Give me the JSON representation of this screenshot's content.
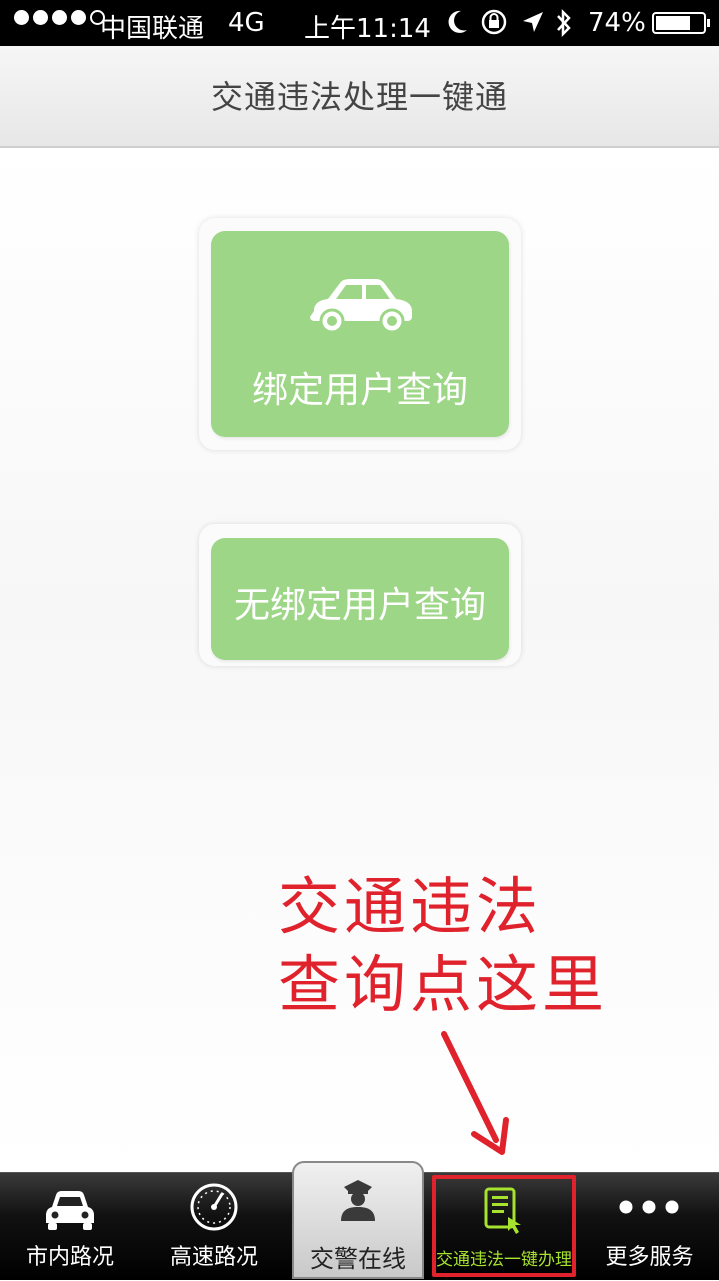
{
  "status_bar": {
    "carrier": "中国联通",
    "network": "4G",
    "time": "上午11:14",
    "battery_percent": "74%",
    "battery_level": 0.74,
    "icons": [
      "signal-dots-icon",
      "moon-icon",
      "rotation-lock-icon",
      "location-icon",
      "bluetooth-icon",
      "battery-icon"
    ]
  },
  "header": {
    "title": "交通违法处理一键通"
  },
  "main": {
    "bound_query": {
      "label": "绑定用户查询",
      "icon": "car-icon"
    },
    "unbound_query": {
      "label": "无绑定用户查询"
    }
  },
  "annotation": {
    "line1": "交通违法",
    "line2": "查询点这里",
    "color": "#e0222c"
  },
  "tabbar": {
    "tabs": [
      {
        "label": "市内路况",
        "icon": "car-front-icon"
      },
      {
        "label": "高速路况",
        "icon": "speedometer-icon"
      },
      {
        "label": "交警在线",
        "icon": "police-officer-icon"
      },
      {
        "label": "交通违法一键办理",
        "icon": "tablet-touch-icon",
        "active": true
      },
      {
        "label": "更多服务",
        "icon": "more-dots-icon"
      }
    ],
    "accent": "#a6e22e"
  },
  "colors": {
    "button_green": "#9dd686",
    "highlight_red": "#e0222c"
  }
}
